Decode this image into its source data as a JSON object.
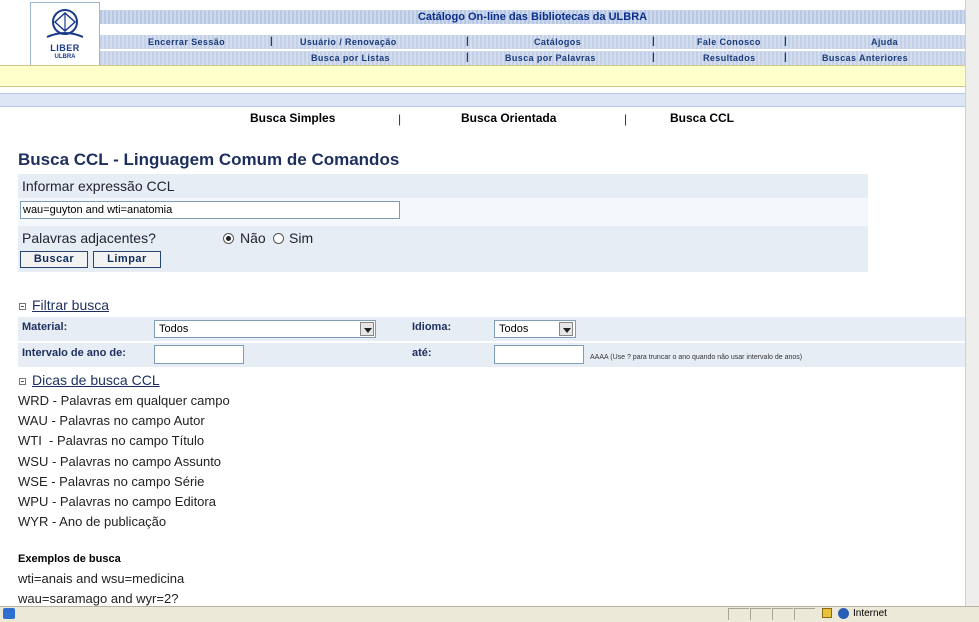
{
  "header": {
    "title": "Catálogo On-line das Bibliotecas da ULBRA",
    "logo_text": "LIBER",
    "logo_sub": "ULBRA",
    "nav_row1": [
      "Encerrar Sessão",
      "Usuário / Renovação",
      "Catálogos",
      "Fale Conosco",
      "Ajuda"
    ],
    "nav_row2": [
      "Busca por Listas",
      "Busca por Palavras",
      "Resultados",
      "Buscas Anteriores"
    ]
  },
  "tabs": [
    "Busca Simples",
    "Busca Orientada",
    "Busca CCL"
  ],
  "page_title": "Busca CCL - Linguagem Comum de Comandos",
  "form": {
    "expr_label": "Informar expressão CCL",
    "expr_value": "wau=guyton and wti=anatomia",
    "adjacent_label": "Palavras adjacentes?",
    "opt_no": "Não",
    "opt_yes": "Sim",
    "selected": "Não",
    "search_button": "Buscar",
    "clear_button": "Limpar"
  },
  "filter": {
    "title": "Filtrar busca",
    "material_label": "Material:",
    "material_value": "Todos",
    "idioma_label": "Idioma:",
    "idioma_value": "Todos",
    "year_from_label": "Intervalo de ano de:",
    "year_to_label": "até:",
    "year_hint": "AAAA (Use ? para truncar o ano quando não usar intervalo de anos)"
  },
  "tips": {
    "title": "Dicas de busca CCL",
    "items": [
      "WRD - Palavras em qualquer campo",
      "WAU - Palavras no campo Autor",
      "WTI  - Palavras no campo Título",
      "WSU - Palavras no campo Assunto",
      "WSE - Palavras no campo Série",
      "WPU - Palavras no campo Editora",
      "WYR - Ano de publicação"
    ],
    "examples_title": "Exemplos de busca",
    "examples": [
      "wti=anais and wsu=medicina",
      "wau=saramago and wyr=2?"
    ]
  },
  "statusbar": {
    "zone": "Internet"
  }
}
